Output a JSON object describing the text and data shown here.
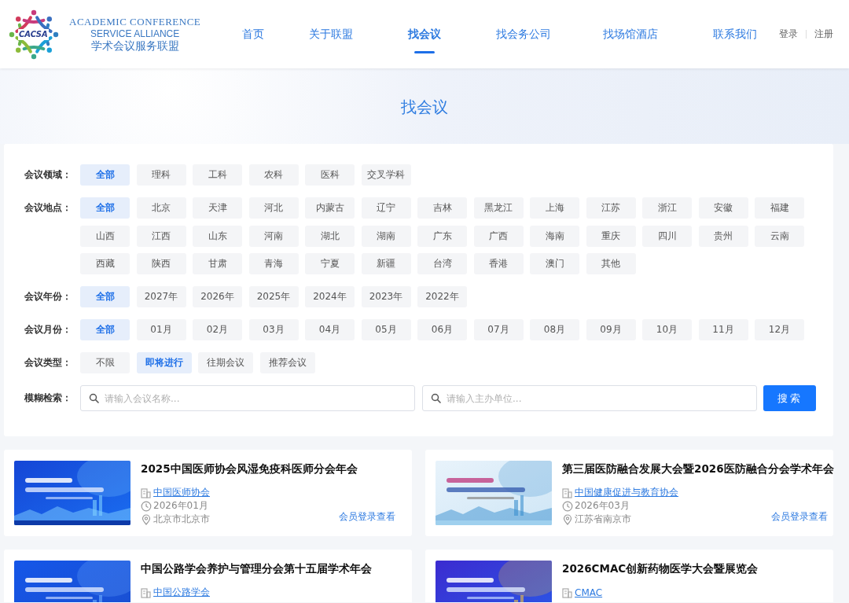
{
  "logo": {
    "mark": "CACSA",
    "line_1": "ACADEMIC CONFERENCE",
    "line_2": "SERVICE ALLIANCE",
    "line_3": "学术会议服务联盟"
  },
  "nav": [
    {
      "label": "首页",
      "selected": false
    },
    {
      "label": "关于联盟",
      "selected": false
    },
    {
      "label": "找会议",
      "selected": true
    },
    {
      "label": "找会务公司",
      "selected": false
    },
    {
      "label": "找场馆酒店",
      "selected": false
    },
    {
      "label": "联系我们",
      "selected": false
    }
  ],
  "account": [
    "登录",
    "注册"
  ],
  "page_title": "找会议",
  "filters": [
    {
      "label": "会议领域：",
      "options": [
        {
          "label": "全部",
          "selected": true
        },
        {
          "label": "理科",
          "selected": false
        },
        {
          "label": "工科",
          "selected": false
        },
        {
          "label": "农科",
          "selected": false
        },
        {
          "label": "医科",
          "selected": false
        },
        {
          "label": "交叉学科",
          "selected": false
        }
      ]
    },
    {
      "label": "会议地点：",
      "options": [
        {
          "label": "全部",
          "selected": true
        },
        {
          "label": "北京",
          "selected": false
        },
        {
          "label": "天津",
          "selected": false
        },
        {
          "label": "河北",
          "selected": false
        },
        {
          "label": "内蒙古",
          "selected": false
        },
        {
          "label": "辽宁",
          "selected": false
        },
        {
          "label": "吉林",
          "selected": false
        },
        {
          "label": "黑龙江",
          "selected": false
        },
        {
          "label": "上海",
          "selected": false
        },
        {
          "label": "江苏",
          "selected": false
        },
        {
          "label": "浙江",
          "selected": false
        },
        {
          "label": "安徽",
          "selected": false
        },
        {
          "label": "福建",
          "selected": false
        },
        {
          "label": "山西",
          "selected": false
        },
        {
          "label": "江西",
          "selected": false
        },
        {
          "label": "山东",
          "selected": false
        },
        {
          "label": "河南",
          "selected": false
        },
        {
          "label": "湖北",
          "selected": false
        },
        {
          "label": "湖南",
          "selected": false
        },
        {
          "label": "广东",
          "selected": false
        },
        {
          "label": "广西",
          "selected": false
        },
        {
          "label": "海南",
          "selected": false
        },
        {
          "label": "重庆",
          "selected": false
        },
        {
          "label": "四川",
          "selected": false
        },
        {
          "label": "贵州",
          "selected": false
        },
        {
          "label": "云南",
          "selected": false
        },
        {
          "label": "西藏",
          "selected": false
        },
        {
          "label": "陕西",
          "selected": false
        },
        {
          "label": "甘肃",
          "selected": false
        },
        {
          "label": "青海",
          "selected": false
        },
        {
          "label": "宁夏",
          "selected": false
        },
        {
          "label": "新疆",
          "selected": false
        },
        {
          "label": "台湾",
          "selected": false
        },
        {
          "label": "香港",
          "selected": false
        },
        {
          "label": "澳门",
          "selected": false
        },
        {
          "label": "其他",
          "selected": false
        }
      ]
    },
    {
      "label": "会议年份：",
      "options": [
        {
          "label": "全部",
          "selected": true
        },
        {
          "label": "2027年",
          "selected": false
        },
        {
          "label": "2026年",
          "selected": false
        },
        {
          "label": "2025年",
          "selected": false
        },
        {
          "label": "2024年",
          "selected": false
        },
        {
          "label": "2023年",
          "selected": false
        },
        {
          "label": "2022年",
          "selected": false
        }
      ]
    },
    {
      "label": "会议月份：",
      "options": [
        {
          "label": "全部",
          "selected": true
        },
        {
          "label": "01月",
          "selected": false
        },
        {
          "label": "02月",
          "selected": false
        },
        {
          "label": "03月",
          "selected": false
        },
        {
          "label": "04月",
          "selected": false
        },
        {
          "label": "05月",
          "selected": false
        },
        {
          "label": "06月",
          "selected": false
        },
        {
          "label": "07月",
          "selected": false
        },
        {
          "label": "08月",
          "selected": false
        },
        {
          "label": "09月",
          "selected": false
        },
        {
          "label": "10月",
          "selected": false
        },
        {
          "label": "11月",
          "selected": false
        },
        {
          "label": "12月",
          "selected": false
        }
      ]
    },
    {
      "label": "会议类型：",
      "options": [
        {
          "label": "不限",
          "selected": false
        },
        {
          "label": "即将进行",
          "selected": true
        },
        {
          "label": "往期会议",
          "selected": false
        },
        {
          "label": "推荐会议",
          "selected": false
        }
      ]
    }
  ],
  "search": {
    "label": "模糊检索：",
    "name_placeholder": "请输入会议名称...",
    "organizer_placeholder": "请输入主办单位...",
    "button": "搜索"
  },
  "conferences": [
    {
      "title": "2025中国医师协会风湿免疫科医师分会年会",
      "organizer": "中国医师协会",
      "date": "2026年01月",
      "location": "北京市北京市",
      "action": "会员登录查看"
    },
    {
      "title": "第三届医防融合发展大会暨2026医防融合分会学术年会",
      "organizer": "中国健康促进与教育协会",
      "date": "2026年03月",
      "location": "江苏省南京市",
      "action": "会员登录查看"
    },
    {
      "title": "中国公路学会养护与管理分会第十五届学术年会",
      "organizer": "中国公路学会"
    },
    {
      "title": "2026CMAC创新药物医学大会暨展览会",
      "organizer": "CMAC"
    }
  ]
}
